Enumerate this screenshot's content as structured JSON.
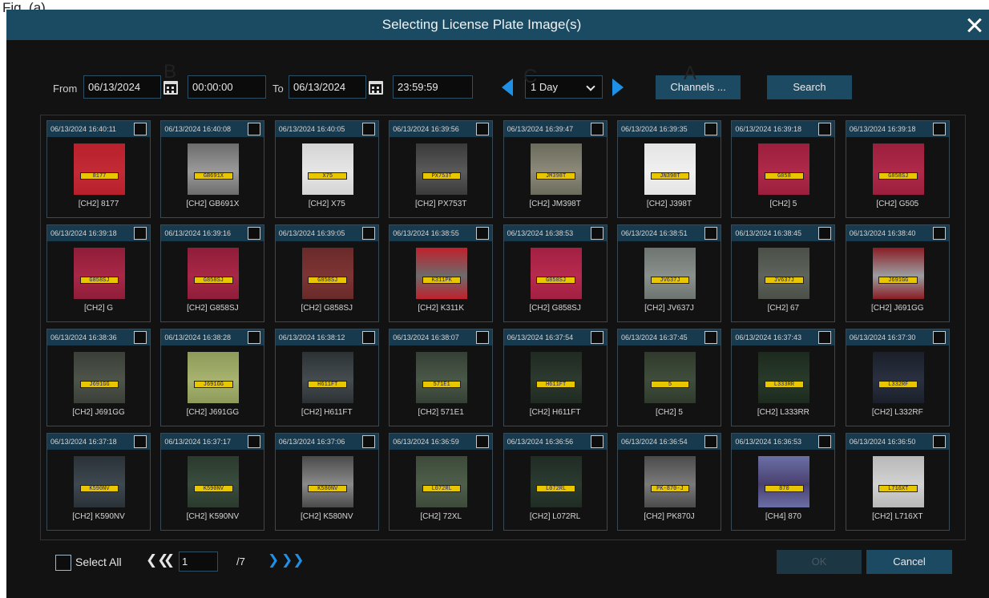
{
  "figure_label": "Fig. (a)",
  "window": {
    "title": "Selecting License Plate Image(s)"
  },
  "toolbar": {
    "from_label": "From",
    "from_date": "06/13/2024",
    "from_time": "00:00:00",
    "to_label": "To",
    "to_date": "06/13/2024",
    "to_time": "23:59:59",
    "range_select": "1 Day",
    "channels_button": "Channels ...",
    "search_button": "Search"
  },
  "markers": {
    "a": "A",
    "b": "B",
    "c": "C"
  },
  "results": [
    {
      "time": "06/13/2024 16:40:11",
      "caption": "[CH2] 8177",
      "plate": "8177",
      "bg": "#b8202c",
      "car": "#c22a35"
    },
    {
      "time": "06/13/2024 16:40:08",
      "caption": "[CH2] GB691X",
      "plate": "GB691X",
      "bg": "#6c6c6c",
      "car": "#9a9a9a"
    },
    {
      "time": "06/13/2024 16:40:05",
      "caption": "[CH2] X75",
      "plate": "X75",
      "bg": "#d4d4d4",
      "car": "#e6e6e6"
    },
    {
      "time": "06/13/2024 16:39:56",
      "caption": "[CH2] PX753T",
      "plate": "PX753T",
      "bg": "#3a3a3a",
      "car": "#5a5a5a"
    },
    {
      "time": "06/13/2024 16:39:47",
      "caption": "[CH2] JM398T",
      "plate": "JM398T",
      "bg": "#6b6b5c",
      "car": "#8d8a7a"
    },
    {
      "time": "06/13/2024 16:39:35",
      "caption": "[CH2] J398T",
      "plate": "JN398T",
      "bg": "#e4e4e4",
      "car": "#f0f0f0"
    },
    {
      "time": "06/13/2024 16:39:18",
      "caption": "[CH2] 5",
      "plate": "G858",
      "bg": "#9a1f3c",
      "car": "#b0294a"
    },
    {
      "time": "06/13/2024 16:39:18",
      "caption": "[CH2] G505",
      "plate": "G858SJ",
      "bg": "#9a1f3c",
      "car": "#b0294a"
    },
    {
      "time": "06/13/2024 16:39:18",
      "caption": "[CH2] G",
      "plate": "G858SJ",
      "bg": "#8f1d3a",
      "car": "#a82846"
    },
    {
      "time": "06/13/2024 16:39:16",
      "caption": "[CH2] G858SJ",
      "plate": "G858SJ",
      "bg": "#8f1d3a",
      "car": "#a82846"
    },
    {
      "time": "06/13/2024 16:39:05",
      "caption": "[CH2] G858SJ",
      "plate": "G858SJ",
      "bg": "#6a2a2a",
      "car": "#7e3434"
    },
    {
      "time": "06/13/2024 16:38:55",
      "caption": "[CH2] K311K",
      "plate": "K311PK",
      "bg": "#c0202c",
      "car": "#6c6c6c"
    },
    {
      "time": "06/13/2024 16:38:53",
      "caption": "[CH2] G858SJ",
      "plate": "G858SJ",
      "bg": "#a22042",
      "car": "#b62a4e"
    },
    {
      "time": "06/13/2024 16:38:51",
      "caption": "[CH2] JV637J",
      "plate": "JV637J",
      "bg": "#6e7470",
      "car": "#8a908c"
    },
    {
      "time": "06/13/2024 16:38:45",
      "caption": "[CH2] 67",
      "plate": "JV637J",
      "bg": "#4a4f48",
      "car": "#5e645c"
    },
    {
      "time": "06/13/2024 16:38:40",
      "caption": "[CH2] J691GG",
      "plate": "J691GG",
      "bg": "#8a1d24",
      "car": "#9b9ea2"
    },
    {
      "time": "06/13/2024 16:38:36",
      "caption": "[CH2] J691GG",
      "plate": "J691GG",
      "bg": "#3a3f38",
      "car": "#4e544a"
    },
    {
      "time": "06/13/2024 16:38:28",
      "caption": "[CH2] J691GG",
      "plate": "J691GG",
      "bg": "#8d9a5a",
      "car": "#a7b36e"
    },
    {
      "time": "06/13/2024 16:38:12",
      "caption": "[CH2] H611FT",
      "plate": "H611FT",
      "bg": "#2c3234",
      "car": "#454c50"
    },
    {
      "time": "06/13/2024 16:38:07",
      "caption": "[CH2] 571E1",
      "plate": "571E1",
      "bg": "#354035",
      "car": "#4a5848"
    },
    {
      "time": "06/13/2024 16:37:54",
      "caption": "[CH2] H611FT",
      "plate": "H611FT",
      "bg": "#1f2a22",
      "car": "#2d3a2f"
    },
    {
      "time": "06/13/2024 16:37:45",
      "caption": "[CH2] 5",
      "plate": "5",
      "bg": "#2f3a2c",
      "car": "#404d3c"
    },
    {
      "time": "06/13/2024 16:37:43",
      "caption": "[CH2] L333RR",
      "plate": "L333RR",
      "bg": "#1c2a1e",
      "car": "#283a2a"
    },
    {
      "time": "06/13/2024 16:37:30",
      "caption": "[CH2] L332RF",
      "plate": "L332RF",
      "bg": "#1a1f2a",
      "car": "#2a3040"
    },
    {
      "time": "06/13/2024 16:37:18",
      "caption": "[CH2] K590NV",
      "plate": "K590NV",
      "bg": "#2a3238",
      "car": "#3e4850"
    },
    {
      "time": "06/13/2024 16:37:17",
      "caption": "[CH2] K590NV",
      "plate": "K590NV",
      "bg": "#2a3a2e",
      "car": "#3a4d3e"
    },
    {
      "time": "06/13/2024 16:37:06",
      "caption": "[CH2] K580NV",
      "plate": "K580NV",
      "bg": "#4a4a4a",
      "car": "#8a8a8a"
    },
    {
      "time": "06/13/2024 16:36:59",
      "caption": "[CH2] 72XL",
      "plate": "L072RL",
      "bg": "#3d4a3a",
      "car": "#4f5e4a"
    },
    {
      "time": "06/13/2024 16:36:56",
      "caption": "[CH2] L072RL",
      "plate": "L072RL",
      "bg": "#1f2c24",
      "car": "#2b3b30"
    },
    {
      "time": "06/13/2024 16:36:54",
      "caption": "[CH2] PK870J",
      "plate": "PK-870-J",
      "bg": "#4b4b4b",
      "car": "#7a7a7a"
    },
    {
      "time": "06/13/2024 16:36:53",
      "caption": "[CH4] 870",
      "plate": "870",
      "bg": "#6a6fa5",
      "car": "#4a4070"
    },
    {
      "time": "06/13/2024 16:36:50",
      "caption": "[CH2] L716XT",
      "plate": "L716XT",
      "bg": "#b8b8b8",
      "car": "#d2d2d2"
    }
  ],
  "footer": {
    "select_all": "Select All",
    "page_value": "1",
    "page_total": "/7",
    "ok_button": "OK",
    "cancel_button": "Cancel"
  },
  "colors": {
    "title_bar": "#1b4a63",
    "tile_header": "#173a4e",
    "accent_arrow": "#1e90e6",
    "ok_disabled": "#1c3644",
    "cancel_button": "#1d4a63"
  }
}
